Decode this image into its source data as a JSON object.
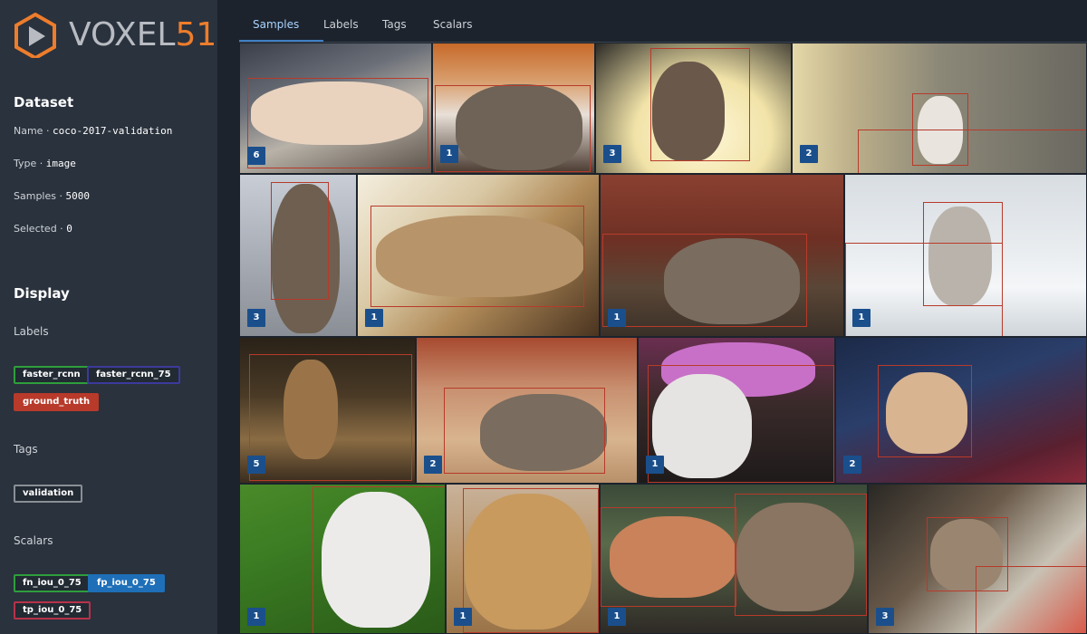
{
  "logo": {
    "text_white": "VOXEL",
    "text_orange": "51",
    "icon": "voxel51-play-icon"
  },
  "dataset": {
    "title": "Dataset",
    "fields": [
      {
        "key": "Name",
        "value": "coco-2017-validation"
      },
      {
        "key": "Type",
        "value": "image"
      },
      {
        "key": "Samples",
        "value": "5000"
      },
      {
        "key": "Selected",
        "value": "0"
      }
    ]
  },
  "display": {
    "title": "Display",
    "labels_title": "Labels",
    "labels": [
      {
        "name": "faster_rcnn",
        "color": "#2e9e3c"
      },
      {
        "name": "faster_rcnn_75",
        "color": "#3c3a9c"
      },
      {
        "name": "ground_truth",
        "color": "#b83a2a"
      }
    ],
    "tags_title": "Tags",
    "tags": [
      {
        "name": "validation",
        "color": "#8a8f96"
      }
    ],
    "scalars_title": "Scalars",
    "scalars": [
      {
        "name": "fn_iou_0_75",
        "color": "#2e9e3c"
      },
      {
        "name": "fp_iou_0_75",
        "color": "#1e6fb8"
      },
      {
        "name": "tp_iou_0_75",
        "color": "#b8324a"
      }
    ]
  },
  "tabs": [
    {
      "label": "Samples",
      "active": true
    },
    {
      "label": "Labels",
      "active": false
    },
    {
      "label": "Tags",
      "active": false
    },
    {
      "label": "Scalars",
      "active": false
    }
  ],
  "samples": [
    {
      "count": "6"
    },
    {
      "count": "1"
    },
    {
      "count": "3"
    },
    {
      "count": "2"
    },
    {
      "count": "3"
    },
    {
      "count": "1"
    },
    {
      "count": "1"
    },
    {
      "count": "1"
    },
    {
      "count": "5"
    },
    {
      "count": "2"
    },
    {
      "count": "1"
    },
    {
      "count": "2"
    },
    {
      "count": "1"
    },
    {
      "count": "1"
    },
    {
      "count": "1"
    },
    {
      "count": "3"
    }
  ],
  "colors": {
    "accent": "#3f7fc4",
    "box": "#b83a2a",
    "badge": "#1a4f8c"
  }
}
